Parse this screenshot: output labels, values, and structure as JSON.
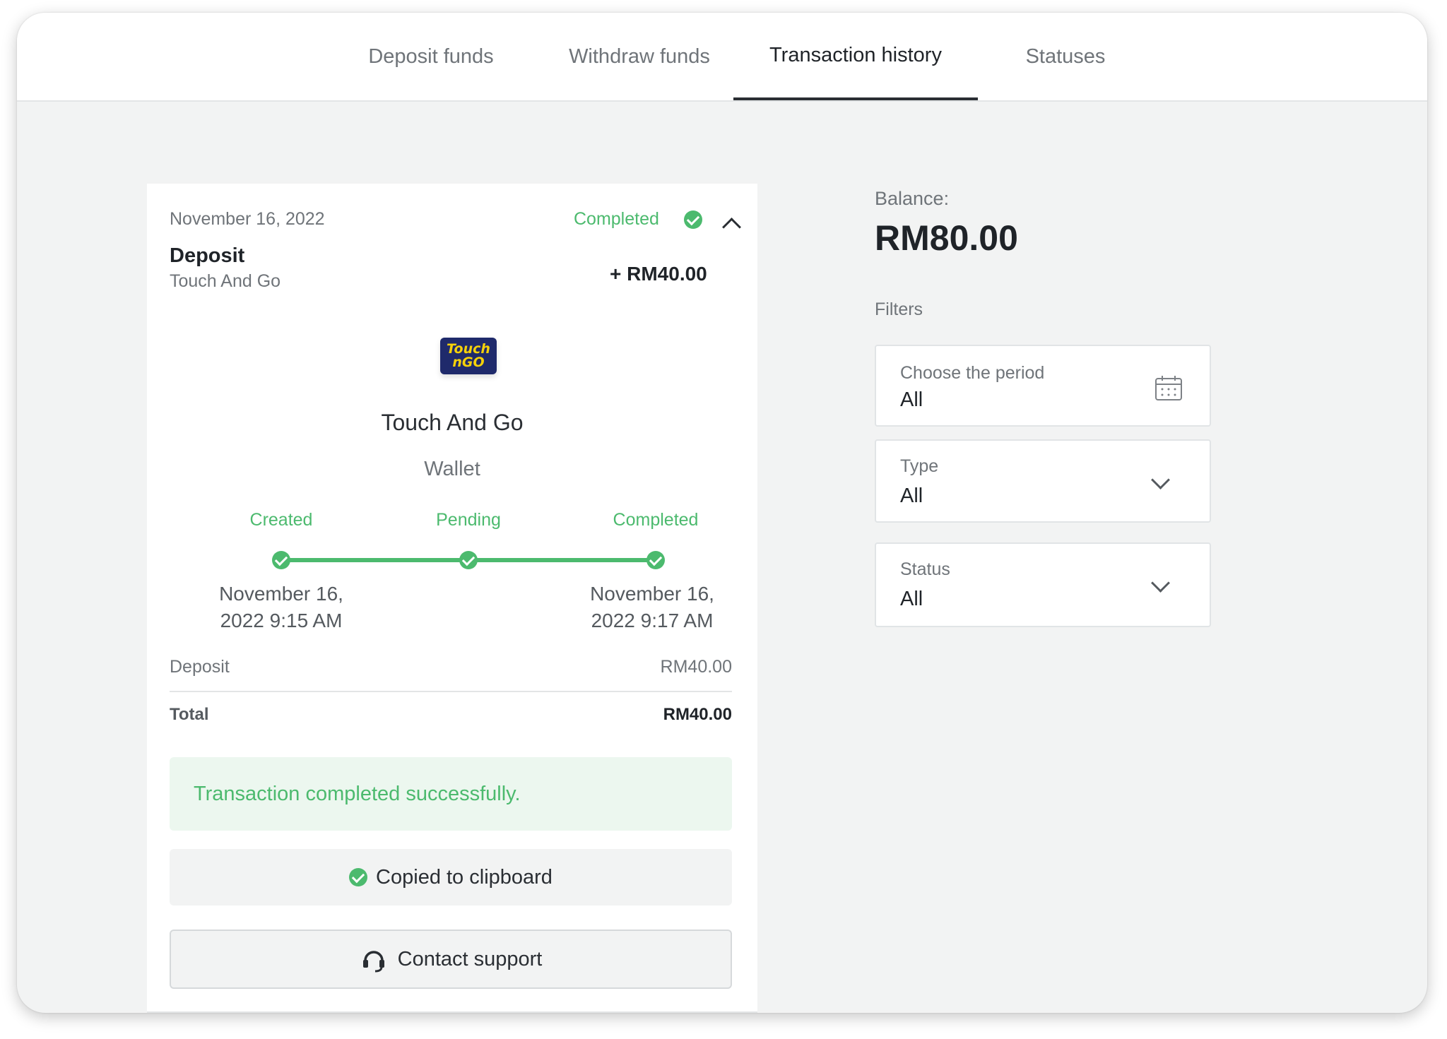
{
  "tabs": [
    {
      "label": "Deposit funds",
      "active": false
    },
    {
      "label": "Withdraw funds",
      "active": false
    },
    {
      "label": "Transaction history",
      "active": true
    },
    {
      "label": "Statuses",
      "active": false
    }
  ],
  "transaction": {
    "date": "November 16, 2022",
    "status": "Completed",
    "type": "Deposit",
    "method": "Touch And Go",
    "amount": "+ RM40.00",
    "logo_text_top": "Touch",
    "logo_text_bottom": "nGO",
    "provider_name": "Touch And Go",
    "provider_kind": "Wallet",
    "steps": [
      {
        "label": "Created",
        "time_line1": "November 16,",
        "time_line2": "2022 9:15 AM"
      },
      {
        "label": "Pending",
        "time_line1": "",
        "time_line2": ""
      },
      {
        "label": "Completed",
        "time_line1": "November 16,",
        "time_line2": "2022 9:17 AM"
      }
    ],
    "summary": {
      "deposit_label": "Deposit",
      "deposit_value": "RM40.00",
      "total_label": "Total",
      "total_value": "RM40.00"
    },
    "success_message": "Transaction completed successfully.",
    "copied_label": "Copied to clipboard",
    "support_label": "Contact support"
  },
  "balance": {
    "label": "Balance:",
    "value": "RM80.00"
  },
  "filters": {
    "title": "Filters",
    "period": {
      "label": "Choose the period",
      "value": "All"
    },
    "type": {
      "label": "Type",
      "value": "All"
    },
    "status": {
      "label": "Status",
      "value": "All"
    }
  },
  "colors": {
    "success": "#4cba6e",
    "success_bg": "#ecf7ef",
    "background": "#f2f3f3",
    "text": "#1f2328",
    "muted": "#6f7479",
    "logo_bg": "#1f2a6b",
    "logo_fg": "#f5d10a"
  }
}
